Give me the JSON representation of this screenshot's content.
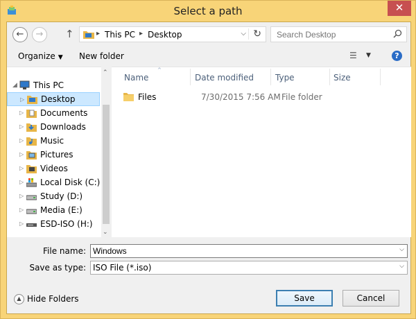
{
  "window": {
    "title": "Select a path",
    "close_glyph": "✕"
  },
  "address": {
    "back_glyph": "←",
    "forward_glyph": "→",
    "up_glyph": "↑",
    "crumbs": [
      "This PC",
      "Desktop"
    ],
    "separator_glyph": "▸",
    "dropdown_glyph": "⌵",
    "refresh_glyph": "↻"
  },
  "search": {
    "placeholder": "Search Desktop",
    "icon": "search-icon"
  },
  "toolbar": {
    "organize_label": "Organize",
    "organize_caret": "▼",
    "new_folder_label": "New folder",
    "view_glyph": "☰",
    "view_caret": "▼",
    "help_glyph": "?"
  },
  "nav_tree": {
    "items": [
      {
        "label": "This PC",
        "icon": "computer-icon",
        "expanded": true
      },
      {
        "label": "Desktop",
        "icon": "desktop-folder-icon",
        "selected": true
      },
      {
        "label": "Documents",
        "icon": "documents-folder-icon"
      },
      {
        "label": "Downloads",
        "icon": "downloads-folder-icon"
      },
      {
        "label": "Music",
        "icon": "music-folder-icon"
      },
      {
        "label": "Pictures",
        "icon": "pictures-folder-icon"
      },
      {
        "label": "Videos",
        "icon": "videos-folder-icon"
      },
      {
        "label": "Local Disk (C:)",
        "icon": "system-drive-icon"
      },
      {
        "label": "Study (D:)",
        "icon": "drive-icon"
      },
      {
        "label": "Media (E:)",
        "icon": "drive-icon"
      },
      {
        "label": "ESD-ISO (H:)",
        "icon": "usb-drive-icon"
      }
    ],
    "expand_glyph": "▷",
    "expanded_glyph": "◢",
    "scroll_up_glyph": "⌃",
    "scroll_down_glyph": "⌄"
  },
  "file_list": {
    "columns": [
      "Name",
      "Date modified",
      "Type",
      "Size"
    ],
    "sort_glyph": "^",
    "rows": [
      {
        "name": "Files",
        "date": "7/30/2015 7:56 AM",
        "type": "File folder",
        "size": ""
      }
    ]
  },
  "save_form": {
    "file_name_label": "File name:",
    "file_name_value": "Windows",
    "save_as_type_label": "Save as type:",
    "save_as_type_value": "ISO File (*.iso)",
    "dropdown_glyph": "⌵"
  },
  "footer": {
    "hide_folders_label": "Hide Folders",
    "hide_folders_glyph": "▲",
    "save_label": "Save",
    "cancel_label": "Cancel"
  },
  "colors": {
    "window_frame": "#f8d478",
    "close_button": "#c75050",
    "selection": "#cce8ff",
    "column_header_text": "#4c607a",
    "default_button_border": "#3c7fb1"
  }
}
